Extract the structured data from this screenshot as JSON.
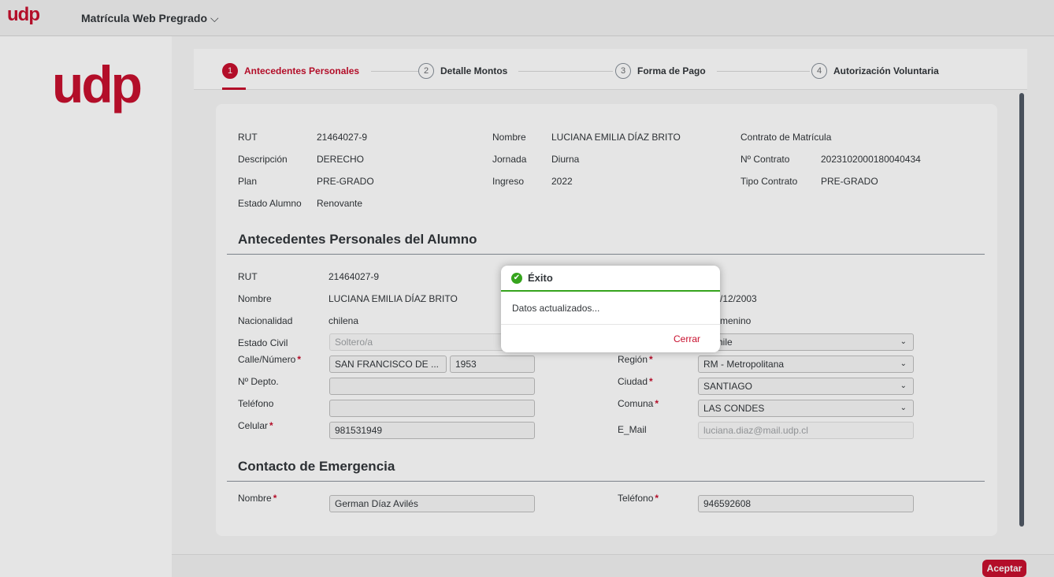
{
  "header": {
    "logo": "udp",
    "app_title": "Matrícula Web Pregrado",
    "chevron": "⌵"
  },
  "brand": {
    "logo": "udp",
    "color": "#c8102e"
  },
  "wizard": {
    "steps": [
      {
        "num": "1",
        "label": "Antecedentes Personales"
      },
      {
        "num": "2",
        "label": "Detalle Montos"
      },
      {
        "num": "3",
        "label": "Forma de Pago"
      },
      {
        "num": "4",
        "label": "Autorización Voluntaria"
      }
    ]
  },
  "summary": {
    "rut_label": "RUT",
    "rut": "21464027-9",
    "desc_label": "Descripción",
    "desc": "DERECHO",
    "plan_label": "Plan",
    "plan": "PRE-GRADO",
    "estado_label": "Estado Alumno",
    "estado": "Renovante",
    "nombre_label": "Nombre",
    "nombre": "LUCIANA EMILIA DÍAZ BRITO",
    "jornada_label": "Jornada",
    "jornada": "Diurna",
    "ingreso_label": "Ingreso",
    "ingreso": "2022",
    "contrato_heading": "Contrato de Matrícula",
    "ncontrato_label": "Nº Contrato",
    "ncontrato": "2023102000180040434",
    "tipo_label": "Tipo Contrato",
    "tipo": "PRE-GRADO"
  },
  "personal": {
    "title": "Antecedentes Personales del Alumno",
    "rut_label": "RUT",
    "rut": "21464027-9",
    "nombre_label": "Nombre",
    "nombre": "LUCIANA EMILIA DÍAZ BRITO",
    "nacionalidad_label": "Nacionalidad",
    "nacionalidad": "chilena",
    "estado_civil_label": "Estado Civil",
    "estado_civil": "Soltero/a",
    "calle_label": "Calle/Número",
    "calle": "SAN FRANCISCO DE ...",
    "numero": "1953",
    "depto_label": "Nº Depto.",
    "depto": "",
    "telefono_label": "Teléfono",
    "telefono": "",
    "celular_label": "Celular",
    "celular": "981531949",
    "fecha_partial": "/12/2003",
    "sexo_partial": "menino",
    "pais_partial": "hile",
    "region_label": "Región",
    "region": "RM - Metropolitana",
    "ciudad_label": "Ciudad",
    "ciudad": "SANTIAGO",
    "comuna_label": "Comuna",
    "comuna": "LAS CONDES",
    "email_label": "E_Mail",
    "email": "luciana.diaz@mail.udp.cl"
  },
  "emergency": {
    "title": "Contacto de Emergencia",
    "nombre_label": "Nombre",
    "nombre": "German Díaz Avilés",
    "telefono_label": "Teléfono",
    "telefono": "946592608"
  },
  "dialog": {
    "title": "Éxito",
    "message": "Datos actualizados...",
    "close_label": "Cerrar",
    "check": "✔"
  },
  "footer": {
    "accept_label": "Aceptar"
  },
  "required_mark": "*",
  "select_arrow": "⌄"
}
